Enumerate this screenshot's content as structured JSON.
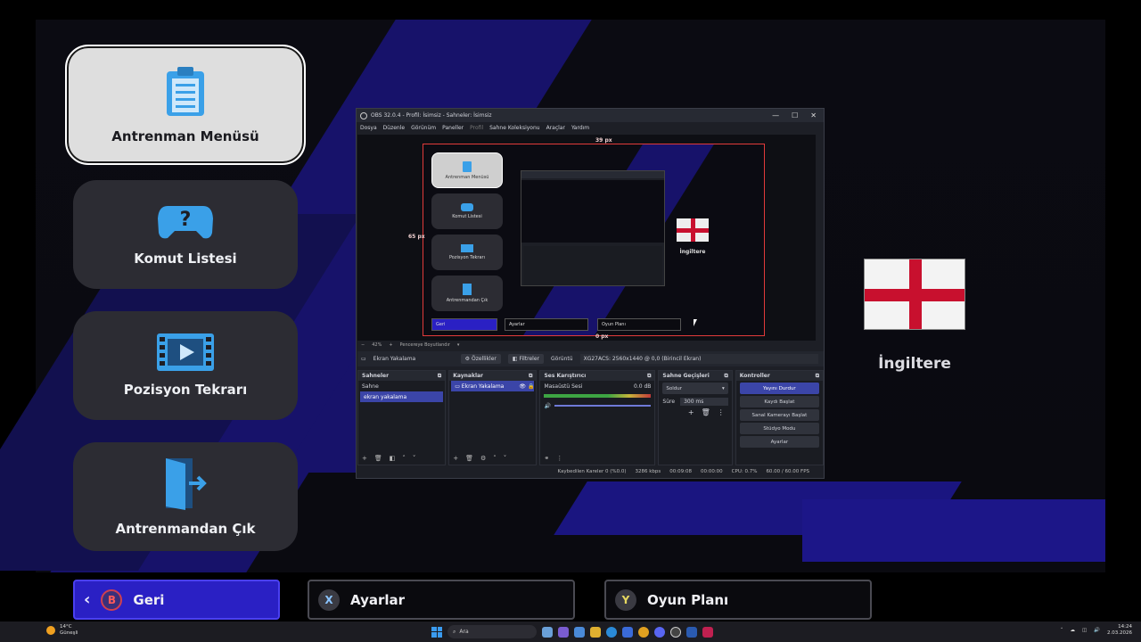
{
  "menu": {
    "items": [
      {
        "label": "Antrenman Menüsü",
        "icon": "clipboard-icon",
        "active": true
      },
      {
        "label": "Komut Listesi",
        "icon": "gamepad-question-icon",
        "active": false
      },
      {
        "label": "Pozisyon Tekrarı",
        "icon": "film-replay-icon",
        "active": false
      },
      {
        "label": "Antrenmandan Çık",
        "icon": "exit-door-icon",
        "active": false
      }
    ]
  },
  "bottom_buttons": {
    "back": {
      "key": "B",
      "label": "Geri"
    },
    "settings": {
      "key": "X",
      "label": "Ayarlar"
    },
    "gameplan": {
      "key": "Y",
      "label": "Oyun Planı"
    }
  },
  "team": {
    "name": "İngiltere",
    "flag": "england-flag"
  },
  "obs": {
    "title": "OBS 32.0.4 - Profil: İsimsiz - Sahneler: İsimsiz",
    "menu": [
      "Dosya",
      "Düzenle",
      "Görünüm",
      "Paneller",
      "Profil",
      "Sahne Koleksiyonu",
      "Araçlar",
      "Yardım"
    ],
    "preview": {
      "top_offset_label": "39 px",
      "left_offset_label": "65 px",
      "bottom_offset_label": "0 px",
      "mini_menu": [
        "Antrenman Menüsü",
        "Komut Listesi",
        "Pozisyon Tekrarı",
        "Antrenmandan Çık"
      ],
      "mini_bottom": [
        "Geri",
        "Ayarlar",
        "Oyun Planı"
      ],
      "mini_team": "İngiltere"
    },
    "zoom": {
      "value": "42%",
      "mode": "Pencereye Boyutlandır"
    },
    "source_bar": {
      "source": "Ekran Yakalama",
      "properties": "Özellikler",
      "filters": "Filtreler",
      "display_label": "Görüntü",
      "display_value": "XG27ACS: 2560x1440 @ 0,0 (Birincil Ekran)"
    },
    "docks": {
      "scenes": {
        "title": "Sahneler",
        "items": [
          "Sahne",
          "ekran yakalama"
        ]
      },
      "sources": {
        "title": "Kaynaklar",
        "items": [
          "Ekran Yakalama"
        ]
      },
      "mixer": {
        "title": "Ses Karıştırıcı",
        "channel": "Masaüstü Sesi",
        "db": "0.0 dB"
      },
      "transitions": {
        "title": "Sahne Geçişleri",
        "type": "Soldur",
        "duration_label": "Süre",
        "duration": "300 ms"
      },
      "controls": {
        "title": "Kontroller",
        "buttons": [
          "Yayını Durdur",
          "Kaydı Başlat",
          "Sanal Kamerayı Başlat",
          "Stüdyo Modu",
          "Ayarlar"
        ]
      }
    },
    "status": {
      "dropped": "Kaybedilen Kareler 0 (%0.0)",
      "bitrate": "3286 kbps",
      "stream_time": "00:09:08",
      "rec_time": "00:00:00",
      "cpu": "CPU: 0.7%",
      "fps": "60.00 / 60.00 FPS"
    }
  },
  "taskbar": {
    "weather_temp": "14°C",
    "weather_desc": "Güneşli",
    "search_placeholder": "Ara",
    "time": "14:24",
    "date": "2.03.2026"
  },
  "colors": {
    "accent": "#2a20c4",
    "stripe": "#1a1470",
    "flag_red": "#c8102e",
    "obs_select": "#3b45a8"
  }
}
